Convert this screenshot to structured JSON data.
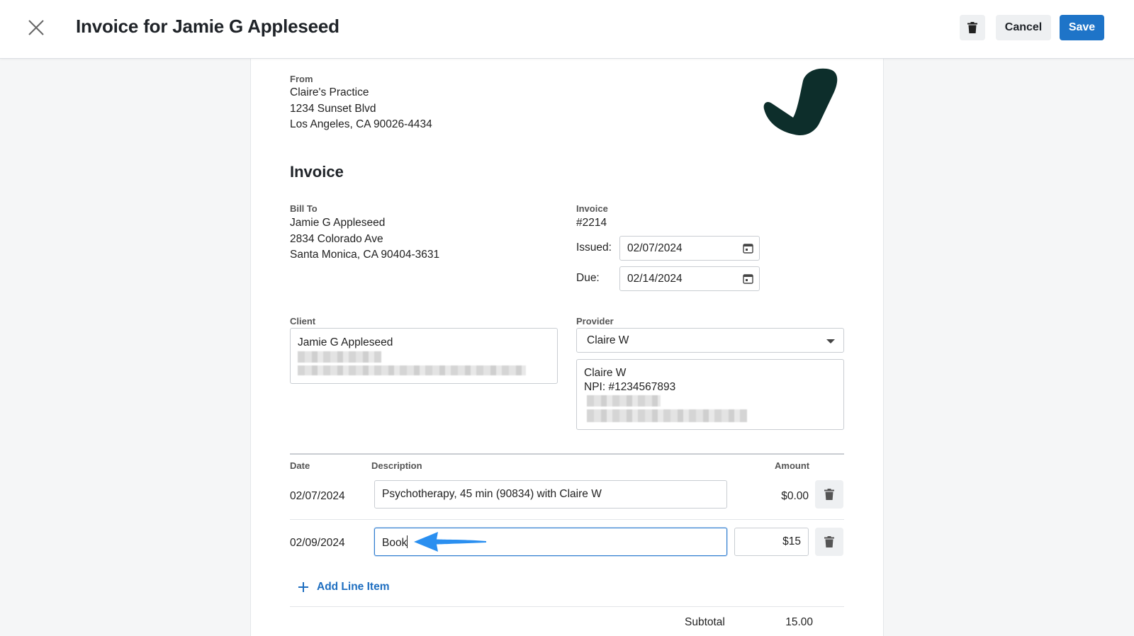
{
  "header": {
    "title": "Invoice for Jamie G Appleseed",
    "cancel_label": "Cancel",
    "save_label": "Save"
  },
  "from": {
    "label": "From",
    "name": "Claire's Practice",
    "address_line1": "1234 Sunset Blvd",
    "address_line2": "Los Angeles, CA 90026-4434"
  },
  "invoice_heading": "Invoice",
  "bill_to": {
    "label": "Bill To",
    "name": "Jamie G Appleseed",
    "address_line1": "2834 Colorado Ave",
    "address_line2": "Santa Monica, CA 90404-3631"
  },
  "invoice_meta": {
    "label": "Invoice",
    "number": "#2214",
    "issued_label": "Issued:",
    "issued_value": "02/07/2024",
    "due_label": "Due:",
    "due_value": "02/14/2024"
  },
  "client": {
    "label": "Client",
    "name": "Jamie G Appleseed"
  },
  "provider": {
    "label": "Provider",
    "selected": "Claire W",
    "details_name": "Claire W",
    "details_npi": "NPI: #1234567893"
  },
  "table": {
    "headers": {
      "date": "Date",
      "description": "Description",
      "amount": "Amount"
    },
    "rows": [
      {
        "date": "02/07/2024",
        "description": "Psychotherapy, 45 min (90834) with Claire W",
        "amount": "$0.00"
      },
      {
        "date": "02/09/2024",
        "description": "Book",
        "amount": "$15"
      }
    ]
  },
  "add_line_item_label": "Add Line Item",
  "totals": {
    "subtotal_label": "Subtotal",
    "subtotal_value": "15.00"
  },
  "colors": {
    "accent": "#1e74c8",
    "logo": "#0d2e2b",
    "annotation_arrow": "#2a8ff0"
  }
}
